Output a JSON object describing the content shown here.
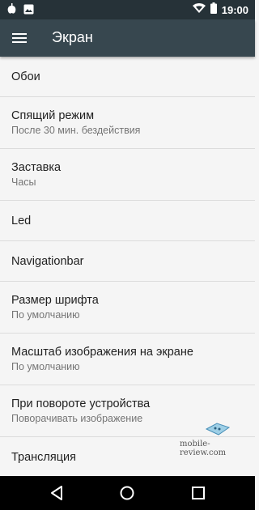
{
  "status_bar": {
    "time": "19:00",
    "left_icons": [
      "app-notification-icon",
      "image-icon"
    ],
    "right_icons": [
      "wifi-icon",
      "battery-icon"
    ]
  },
  "toolbar": {
    "menu_icon": "hamburger-menu-icon",
    "title": "Экран"
  },
  "settings": [
    {
      "title": "Обои"
    },
    {
      "title": "Спящий режим",
      "subtitle": "После 30 мин. бездействия"
    },
    {
      "title": "Заставка",
      "subtitle": "Часы"
    },
    {
      "title": "Led"
    },
    {
      "title": "Navigationbar"
    },
    {
      "title": "Размер шрифта",
      "subtitle": "По умолчанию"
    },
    {
      "title": "Масштаб изображения на экране",
      "subtitle": "По умолчанию"
    },
    {
      "title": "При повороте устройства",
      "subtitle": "Поворачивать изображение"
    },
    {
      "title": "Трансляция"
    }
  ],
  "watermark": {
    "text": "mobile-review.com"
  },
  "nav_bar": {
    "icons": [
      "back-icon",
      "home-icon",
      "recents-icon"
    ]
  },
  "colors": {
    "toolbar": "#37474f",
    "status_bar": "#263238",
    "background": "#f5f5f5"
  }
}
